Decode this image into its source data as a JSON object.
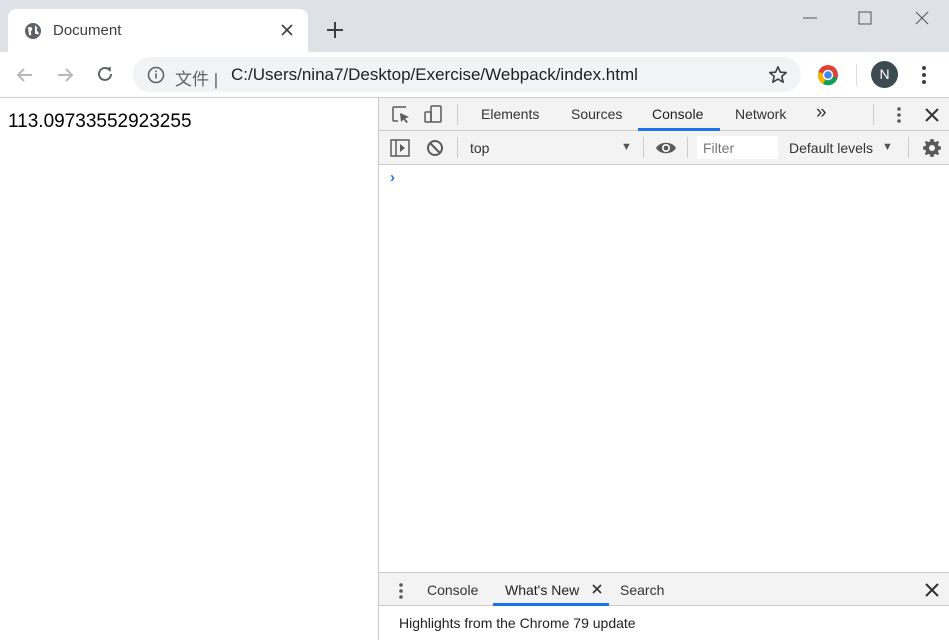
{
  "browser": {
    "tab_title": "Document",
    "omnibox": {
      "scheme_label": "文件 |",
      "url": "C:/Users/nina7/Desktop/Exercise/Webpack/index.html"
    },
    "profile_initial": "N",
    "icons": [
      "globe-icon",
      "close-icon",
      "plus-icon",
      "minimize-icon",
      "maximize-icon",
      "window-close-icon",
      "back-arrow-icon",
      "forward-arrow-icon",
      "reload-icon",
      "info-icon",
      "star-icon",
      "chrome-extension-icon",
      "more-vert-icon"
    ]
  },
  "page": {
    "output_text": "113.09733552923255"
  },
  "devtools": {
    "tabs": [
      "Elements",
      "Sources",
      "Console",
      "Network"
    ],
    "active_tab": "Console",
    "overflow_label": "»",
    "console_bar": {
      "context": "top",
      "filter_placeholder": "Filter",
      "levels": "Default levels"
    },
    "prompt": "›",
    "drawer": {
      "tabs": [
        "Console",
        "What's New",
        "Search"
      ],
      "active_tab": "What's New",
      "content": "Highlights from the Chrome 79 update"
    },
    "accent_color": "#1a73e8"
  }
}
